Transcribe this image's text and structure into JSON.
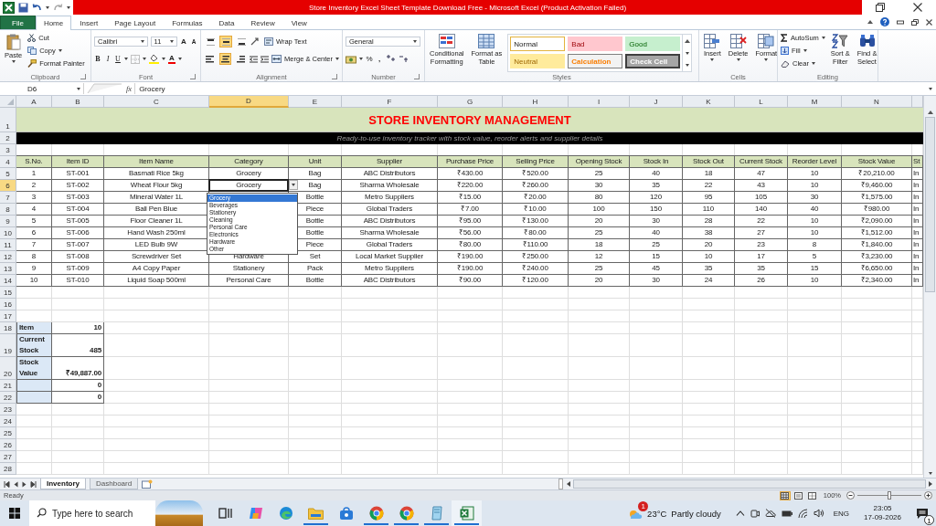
{
  "title_bar": {
    "title": "Store Inventory Excel Sheet Template Download Free  -  Microsoft Excel (Product Activation Failed)"
  },
  "ribbon_tabs": [
    {
      "label": "File",
      "kind": "file",
      "selected": false
    },
    {
      "label": "Home",
      "kind": "tab",
      "selected": true
    },
    {
      "label": "Insert",
      "kind": "tab",
      "selected": false
    },
    {
      "label": "Page Layout",
      "kind": "tab",
      "selected": false
    },
    {
      "label": "Formulas",
      "kind": "tab",
      "selected": false
    },
    {
      "label": "Data",
      "kind": "tab",
      "selected": false
    },
    {
      "label": "Review",
      "kind": "tab",
      "selected": false
    },
    {
      "label": "View",
      "kind": "tab",
      "selected": false
    }
  ],
  "clipboard": {
    "paste": "Paste",
    "cut": "Cut",
    "copy": "Copy",
    "format_painter": "Format Painter",
    "label": "Clipboard"
  },
  "font": {
    "name": "Calibri",
    "size": "11",
    "grow": "A",
    "shrink": "A",
    "bold": "B",
    "italic": "I",
    "underline": "U",
    "color_button": "A",
    "label": "Font"
  },
  "alignment": {
    "vertical": [
      {
        "on": false
      },
      {
        "on": true
      },
      {
        "on": false
      }
    ],
    "horizontal": [
      {
        "on": false
      },
      {
        "on": true
      },
      {
        "on": false
      }
    ],
    "wrap": "Wrap Text",
    "merge": "Merge & Center",
    "label": "Alignment"
  },
  "number": {
    "format": "General",
    "percent": "%",
    "comma": ",",
    "label": "Number"
  },
  "styles": {
    "conditional": "Conditional\nFormatting",
    "format_table": "Format as\nTable",
    "label": "Styles",
    "gallery": [
      {
        "label": "Normal",
        "kind": "normal"
      },
      {
        "label": "Bad",
        "kind": "bad"
      },
      {
        "label": "Good",
        "kind": "good"
      },
      {
        "label": "Neutral",
        "kind": "neutral"
      },
      {
        "label": "Calculation",
        "kind": "calculation"
      },
      {
        "label": "Check Cell",
        "kind": "check"
      }
    ]
  },
  "cells_group": {
    "buttons": [
      {
        "label": "Insert",
        "kind": "insert"
      },
      {
        "label": "Delete",
        "kind": "delete"
      },
      {
        "label": "Format",
        "kind": "format"
      }
    ],
    "label": "Cells"
  },
  "editing": {
    "autosum": "AutoSum",
    "fill": "Fill",
    "clear": "Clear",
    "sort": "Sort &\nFilter",
    "find": "Find &\nSelect",
    "label": "Editing"
  },
  "formula_bar": {
    "name_box": "D6",
    "function_label": "fx",
    "value": "Grocery"
  },
  "sheet": {
    "title": "STORE INVENTORY MANAGEMENT",
    "subtitle": "Ready-to-use inventory tracker with stock value, reorder alerts and supplier details",
    "columns": [
      {
        "letter": "A",
        "selected": false
      },
      {
        "letter": "B",
        "selected": false
      },
      {
        "letter": "C",
        "selected": false
      },
      {
        "letter": "D",
        "selected": true
      },
      {
        "letter": "E",
        "selected": false
      },
      {
        "letter": "F",
        "selected": false
      },
      {
        "letter": "G",
        "selected": false
      },
      {
        "letter": "H",
        "selected": false
      },
      {
        "letter": "I",
        "selected": false
      },
      {
        "letter": "J",
        "selected": false
      },
      {
        "letter": "K",
        "selected": false
      },
      {
        "letter": "L",
        "selected": false
      },
      {
        "letter": "M",
        "selected": false
      },
      {
        "letter": "N",
        "selected": false
      }
    ],
    "headers": [
      "S.No.",
      "Item ID",
      "Item Name",
      "Category",
      "Unit",
      "Supplier",
      "Purchase Price",
      "Selling Price",
      "Opening Stock",
      "Stock In",
      "Stock Out",
      "Current Stock",
      "Reorder Level",
      "Stock Value",
      "St"
    ],
    "rows": [
      {
        "number": "1",
        "kind": "title",
        "selected": false
      },
      {
        "number": "2",
        "kind": "subtitle",
        "selected": false
      },
      {
        "number": "3",
        "kind": "blank",
        "selected": false
      },
      {
        "number": "4",
        "kind": "header",
        "selected": false
      },
      {
        "number": "5",
        "kind": "item",
        "selected": false,
        "cells": [
          "1",
          "ST-001",
          "Basmati Rice 5kg",
          "Grocery",
          "Bag",
          "ABC Distributors",
          "₹430.00",
          "₹520.00",
          "25",
          "40",
          "18",
          "47",
          "10",
          "₹20,210.00",
          "In"
        ]
      },
      {
        "number": "6",
        "kind": "item",
        "selected": true,
        "cells": [
          "2",
          "ST-002",
          "Wheat Flour 5kg",
          "Grocery",
          "Bag",
          "Sharma Wholesale",
          "₹220.00",
          "₹260.00",
          "30",
          "35",
          "22",
          "43",
          "10",
          "₹9,460.00",
          "In"
        ]
      },
      {
        "number": "7",
        "kind": "item",
        "selected": false,
        "cells": [
          "3",
          "ST-003",
          "Mineral Water 1L",
          null,
          "Bottle",
          "Metro Suppliers",
          "₹15.00",
          "₹20.00",
          "80",
          "120",
          "95",
          "105",
          "30",
          "₹1,575.00",
          "In"
        ]
      },
      {
        "number": "8",
        "kind": "item",
        "selected": false,
        "cells": [
          "4",
          "ST-004",
          "Ball Pen Blue",
          null,
          "Piece",
          "Global Traders",
          "₹7.00",
          "₹10.00",
          "100",
          "150",
          "110",
          "140",
          "40",
          "₹980.00",
          "In"
        ]
      },
      {
        "number": "9",
        "kind": "item",
        "selected": false,
        "cells": [
          "5",
          "ST-005",
          "Floor Cleaner 1L",
          null,
          "Bottle",
          "ABC Distributors",
          "₹95.00",
          "₹130.00",
          "20",
          "30",
          "28",
          "22",
          "10",
          "₹2,090.00",
          "In"
        ]
      },
      {
        "number": "10",
        "kind": "item",
        "selected": false,
        "cells": [
          "6",
          "ST-006",
          "Hand Wash 250ml",
          null,
          "Bottle",
          "Sharma Wholesale",
          "₹56.00",
          "₹80.00",
          "25",
          "40",
          "38",
          "27",
          "10",
          "₹1,512.00",
          "In"
        ]
      },
      {
        "number": "11",
        "kind": "item",
        "selected": false,
        "cells": [
          "7",
          "ST-007",
          "LED Bulb 9W",
          null,
          "Piece",
          "Global Traders",
          "₹80.00",
          "₹110.00",
          "18",
          "25",
          "20",
          "23",
          "8",
          "₹1,840.00",
          "In"
        ]
      },
      {
        "number": "12",
        "kind": "item",
        "selected": false,
        "cells": [
          "8",
          "ST-008",
          "Screwdriver Set",
          "Hardware",
          "Set",
          "Local Market Supplier",
          "₹190.00",
          "₹250.00",
          "12",
          "15",
          "10",
          "17",
          "5",
          "₹3,230.00",
          "In"
        ]
      },
      {
        "number": "13",
        "kind": "item",
        "selected": false,
        "cells": [
          "9",
          "ST-009",
          "A4 Copy Paper",
          "Stationery",
          "Pack",
          "Metro Suppliers",
          "₹190.00",
          "₹240.00",
          "25",
          "45",
          "35",
          "35",
          "15",
          "₹6,650.00",
          "In"
        ]
      },
      {
        "number": "14",
        "kind": "item",
        "selected": false,
        "cells": [
          "10",
          "ST-010",
          "Liquid Soap 500ml",
          "Personal Care",
          "Bottle",
          "ABC Distributors",
          "₹90.00",
          "₹120.00",
          "20",
          "30",
          "24",
          "26",
          "10",
          "₹2,340.00",
          "In"
        ]
      },
      {
        "number": "15",
        "kind": "blank",
        "selected": false
      },
      {
        "number": "16",
        "kind": "blank",
        "selected": false
      },
      {
        "number": "17",
        "kind": "blank",
        "selected": false
      },
      {
        "number": "18",
        "kind": "summary",
        "selected": false,
        "label": "Item",
        "value": "10"
      },
      {
        "number": "19",
        "kind": "summary",
        "selected": false,
        "label": "Current Stock",
        "value": "485"
      },
      {
        "number": "20",
        "kind": "summary",
        "selected": false,
        "label": "Stock Value",
        "value": "₹49,887.00"
      },
      {
        "number": "21",
        "kind": "summary",
        "selected": false,
        "value": "0"
      },
      {
        "number": "22",
        "kind": "summary",
        "selected": false,
        "value": "0"
      },
      {
        "number": "23",
        "kind": "blank",
        "selected": false
      },
      {
        "number": "24",
        "kind": "blank",
        "selected": false
      },
      {
        "number": "25",
        "kind": "blank",
        "selected": false
      },
      {
        "number": "26",
        "kind": "blank",
        "selected": false
      },
      {
        "number": "27",
        "kind": "blank",
        "selected": false
      },
      {
        "number": "28",
        "kind": "blank",
        "selected": false
      }
    ],
    "dropdown": [
      {
        "label": "Grocery",
        "selected": true
      },
      {
        "label": "Beverages",
        "selected": false
      },
      {
        "label": "Stationery",
        "selected": false
      },
      {
        "label": "Cleaning",
        "selected": false
      },
      {
        "label": "Personal Care",
        "selected": false
      },
      {
        "label": "Electronics",
        "selected": false
      },
      {
        "label": "Hardware",
        "selected": false
      },
      {
        "label": "Other",
        "selected": false
      }
    ]
  },
  "sheet_tabs": [
    {
      "label": "Inventory",
      "selected": true
    },
    {
      "label": "Dashboard",
      "selected": false
    }
  ],
  "status_bar": {
    "status": "Ready",
    "views": [
      {
        "selected": true
      },
      {
        "selected": false
      },
      {
        "selected": false
      }
    ],
    "zoom": "100%",
    "zoom_slider": {
      "level": 0.5
    }
  },
  "taskbar": {
    "search_placeholder": "Type here to search",
    "apps": [
      {
        "kind": "taskview",
        "running": false,
        "selected": false
      },
      {
        "kind": "copilot",
        "running": false,
        "selected": false
      },
      {
        "kind": "edge",
        "running": false,
        "selected": false
      },
      {
        "kind": "folder",
        "running": true,
        "selected": false
      },
      {
        "kind": "store",
        "running": false,
        "selected": false
      },
      {
        "kind": "chrome",
        "running": true,
        "selected": false
      },
      {
        "kind": "chrome",
        "running": true,
        "selected": false
      },
      {
        "kind": "notepad",
        "running": true,
        "selected": false
      },
      {
        "kind": "excel",
        "running": true,
        "selected": true
      }
    ],
    "weather": {
      "badge": "1",
      "temperature": "23°C",
      "condition": "Partly cloudy"
    },
    "language": "ENG",
    "time": "23:05",
    "date": "17-09-2026",
    "notifications": "1"
  }
}
